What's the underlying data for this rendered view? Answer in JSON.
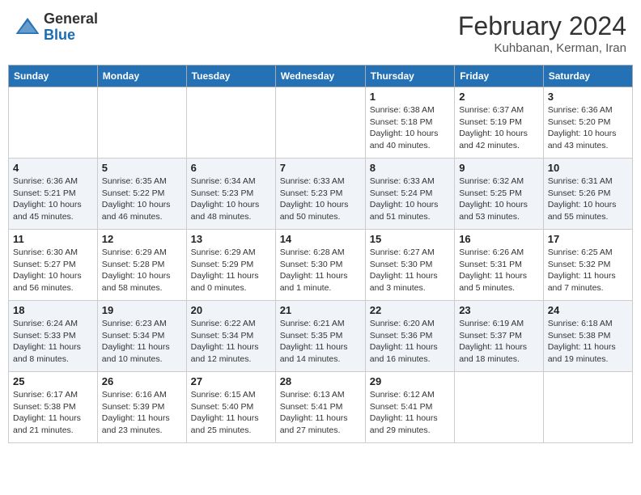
{
  "header": {
    "logo_general": "General",
    "logo_blue": "Blue",
    "month_title": "February 2024",
    "location": "Kuhbanan, Kerman, Iran"
  },
  "days_of_week": [
    "Sunday",
    "Monday",
    "Tuesday",
    "Wednesday",
    "Thursday",
    "Friday",
    "Saturday"
  ],
  "weeks": [
    [
      {
        "num": "",
        "info": ""
      },
      {
        "num": "",
        "info": ""
      },
      {
        "num": "",
        "info": ""
      },
      {
        "num": "",
        "info": ""
      },
      {
        "num": "1",
        "info": "Sunrise: 6:38 AM\nSunset: 5:18 PM\nDaylight: 10 hours\nand 40 minutes."
      },
      {
        "num": "2",
        "info": "Sunrise: 6:37 AM\nSunset: 5:19 PM\nDaylight: 10 hours\nand 42 minutes."
      },
      {
        "num": "3",
        "info": "Sunrise: 6:36 AM\nSunset: 5:20 PM\nDaylight: 10 hours\nand 43 minutes."
      }
    ],
    [
      {
        "num": "4",
        "info": "Sunrise: 6:36 AM\nSunset: 5:21 PM\nDaylight: 10 hours\nand 45 minutes."
      },
      {
        "num": "5",
        "info": "Sunrise: 6:35 AM\nSunset: 5:22 PM\nDaylight: 10 hours\nand 46 minutes."
      },
      {
        "num": "6",
        "info": "Sunrise: 6:34 AM\nSunset: 5:23 PM\nDaylight: 10 hours\nand 48 minutes."
      },
      {
        "num": "7",
        "info": "Sunrise: 6:33 AM\nSunset: 5:23 PM\nDaylight: 10 hours\nand 50 minutes."
      },
      {
        "num": "8",
        "info": "Sunrise: 6:33 AM\nSunset: 5:24 PM\nDaylight: 10 hours\nand 51 minutes."
      },
      {
        "num": "9",
        "info": "Sunrise: 6:32 AM\nSunset: 5:25 PM\nDaylight: 10 hours\nand 53 minutes."
      },
      {
        "num": "10",
        "info": "Sunrise: 6:31 AM\nSunset: 5:26 PM\nDaylight: 10 hours\nand 55 minutes."
      }
    ],
    [
      {
        "num": "11",
        "info": "Sunrise: 6:30 AM\nSunset: 5:27 PM\nDaylight: 10 hours\nand 56 minutes."
      },
      {
        "num": "12",
        "info": "Sunrise: 6:29 AM\nSunset: 5:28 PM\nDaylight: 10 hours\nand 58 minutes."
      },
      {
        "num": "13",
        "info": "Sunrise: 6:29 AM\nSunset: 5:29 PM\nDaylight: 11 hours\nand 0 minutes."
      },
      {
        "num": "14",
        "info": "Sunrise: 6:28 AM\nSunset: 5:30 PM\nDaylight: 11 hours\nand 1 minute."
      },
      {
        "num": "15",
        "info": "Sunrise: 6:27 AM\nSunset: 5:30 PM\nDaylight: 11 hours\nand 3 minutes."
      },
      {
        "num": "16",
        "info": "Sunrise: 6:26 AM\nSunset: 5:31 PM\nDaylight: 11 hours\nand 5 minutes."
      },
      {
        "num": "17",
        "info": "Sunrise: 6:25 AM\nSunset: 5:32 PM\nDaylight: 11 hours\nand 7 minutes."
      }
    ],
    [
      {
        "num": "18",
        "info": "Sunrise: 6:24 AM\nSunset: 5:33 PM\nDaylight: 11 hours\nand 8 minutes."
      },
      {
        "num": "19",
        "info": "Sunrise: 6:23 AM\nSunset: 5:34 PM\nDaylight: 11 hours\nand 10 minutes."
      },
      {
        "num": "20",
        "info": "Sunrise: 6:22 AM\nSunset: 5:34 PM\nDaylight: 11 hours\nand 12 minutes."
      },
      {
        "num": "21",
        "info": "Sunrise: 6:21 AM\nSunset: 5:35 PM\nDaylight: 11 hours\nand 14 minutes."
      },
      {
        "num": "22",
        "info": "Sunrise: 6:20 AM\nSunset: 5:36 PM\nDaylight: 11 hours\nand 16 minutes."
      },
      {
        "num": "23",
        "info": "Sunrise: 6:19 AM\nSunset: 5:37 PM\nDaylight: 11 hours\nand 18 minutes."
      },
      {
        "num": "24",
        "info": "Sunrise: 6:18 AM\nSunset: 5:38 PM\nDaylight: 11 hours\nand 19 minutes."
      }
    ],
    [
      {
        "num": "25",
        "info": "Sunrise: 6:17 AM\nSunset: 5:38 PM\nDaylight: 11 hours\nand 21 minutes."
      },
      {
        "num": "26",
        "info": "Sunrise: 6:16 AM\nSunset: 5:39 PM\nDaylight: 11 hours\nand 23 minutes."
      },
      {
        "num": "27",
        "info": "Sunrise: 6:15 AM\nSunset: 5:40 PM\nDaylight: 11 hours\nand 25 minutes."
      },
      {
        "num": "28",
        "info": "Sunrise: 6:13 AM\nSunset: 5:41 PM\nDaylight: 11 hours\nand 27 minutes."
      },
      {
        "num": "29",
        "info": "Sunrise: 6:12 AM\nSunset: 5:41 PM\nDaylight: 11 hours\nand 29 minutes."
      },
      {
        "num": "",
        "info": ""
      },
      {
        "num": "",
        "info": ""
      }
    ]
  ]
}
